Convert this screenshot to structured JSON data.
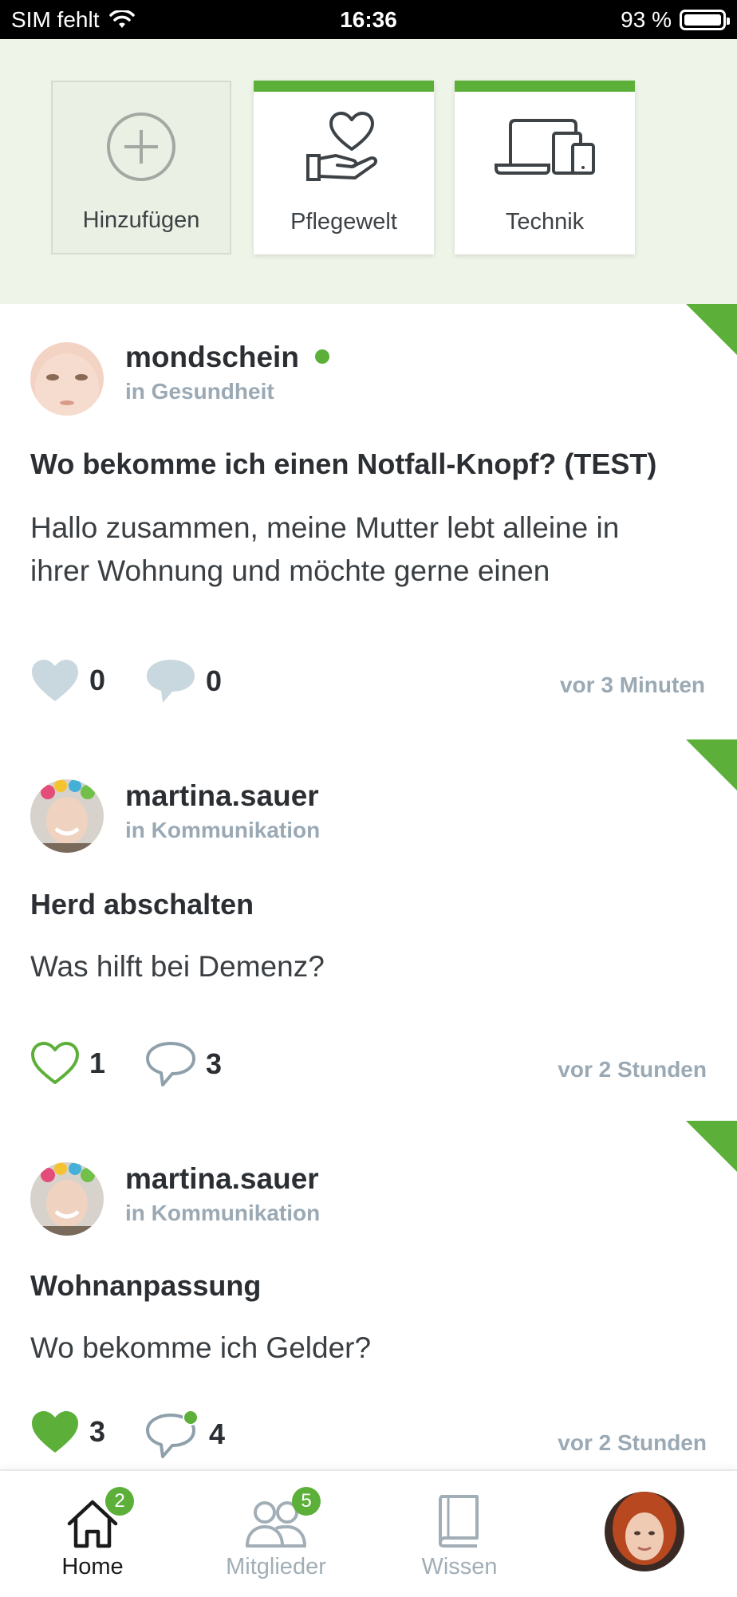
{
  "status_bar": {
    "carrier": "SIM fehlt",
    "time": "16:36",
    "battery": "93 %"
  },
  "categories": {
    "add_label": "Hinzufügen",
    "items": [
      {
        "label": "Pflegewelt",
        "icon": "heart-hand-icon"
      },
      {
        "label": "Technik",
        "icon": "devices-icon"
      }
    ]
  },
  "posts": [
    {
      "username": "mondschein",
      "online": true,
      "category": "in Gesundheit",
      "title": "Wo bekomme ich einen Notfall-Knopf? (TEST)",
      "body_line1": "Hallo zusammen, meine Mutter lebt alleine in",
      "body_line2": "ihrer Wohnung und möchte gerne einen",
      "likes": "0",
      "comments": "0",
      "time": "vor 3 Minuten"
    },
    {
      "username": "martina.sauer",
      "category": "in Kommunikation",
      "title": "Herd abschalten",
      "body_line1": "Was hilft bei Demenz?",
      "likes": "1",
      "comments": "3",
      "time": "vor 2 Stunden"
    },
    {
      "username": "martina.sauer",
      "category": "in Kommunikation",
      "title": "Wohnanpassung",
      "body_line1": "Wo bekomme ich Gelder?",
      "likes": "3",
      "comments": "4",
      "time": "vor 2 Stunden"
    }
  ],
  "nav": {
    "home": {
      "label": "Home",
      "badge": "2"
    },
    "members": {
      "label": "Mitglieder",
      "badge": "5"
    },
    "knowledge": {
      "label": "Wissen"
    }
  },
  "colors": {
    "accent": "#5cb03a",
    "muted": "#9aa9b4",
    "strip_bg": "#eef5e8"
  }
}
